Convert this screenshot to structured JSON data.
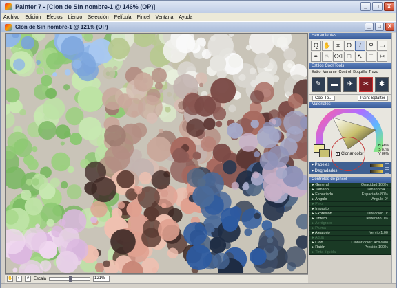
{
  "app": {
    "title": "Painter 7 - [Clon de Sin nombre-1 @ 146% (OP)]",
    "doc_title": "Clon de Sin nombre-1 @ 121% (OP)"
  },
  "menu": [
    "Archivo",
    "Edición",
    "Efectos",
    "Lienzo",
    "Selección",
    "Película",
    "Pincel",
    "Ventana",
    "Ayuda"
  ],
  "window_buttons": {
    "min": "_",
    "max": "□",
    "close": "X"
  },
  "status": {
    "zoom_label": "Escala",
    "zoom_value": "121%",
    "zoom_fraction": 0.5
  },
  "panels": {
    "tools_title": "Herramientas",
    "tools": [
      {
        "icon": "magnifier",
        "glyph": "Q"
      },
      {
        "icon": "hand",
        "glyph": "✋"
      },
      {
        "icon": "crop",
        "glyph": "⌗"
      },
      {
        "icon": "lasso",
        "glyph": "ʘ"
      },
      {
        "icon": "brush",
        "glyph": "/"
      },
      {
        "icon": "dropper",
        "glyph": "⚲"
      },
      {
        "icon": "rectangle",
        "glyph": "▭"
      },
      {
        "icon": "pen",
        "glyph": "✒"
      },
      {
        "icon": "paintbucket",
        "glyph": "♨"
      },
      {
        "icon": "eraser",
        "glyph": "⌫"
      },
      {
        "icon": "shape",
        "glyph": "□"
      },
      {
        "icon": "select",
        "glyph": "↖"
      },
      {
        "icon": "text",
        "glyph": "T"
      },
      {
        "icon": "scissors",
        "glyph": "✂"
      }
    ],
    "brush_title": "Estilos Cool Tools",
    "brush_tabs": [
      "Estilo",
      "Variante",
      "Control",
      "Boquilla",
      "Trazo"
    ],
    "brush_icons": [
      "pencil",
      "charcoal",
      "airbrush",
      "cloner",
      "acrylic"
    ],
    "brush_category": "Cool To...",
    "brush_variant": "Paint Splatter",
    "materials_title": "Materiales",
    "clone_color_label": "Clonar color",
    "hsv": [
      "H 48%",
      "S 81%",
      "V 86%"
    ],
    "drawers": [
      "Papeles",
      "Degradados"
    ],
    "controls_title": "Controles de pincel",
    "controls": [
      {
        "label": "General",
        "value": "Opacidad 100%",
        "enabled": true
      },
      {
        "label": "Tamaño",
        "value": "Tamaño 54.7",
        "enabled": true
      },
      {
        "label": "Espaciado",
        "value": "Espaciado 80%",
        "enabled": true
      },
      {
        "label": "Ángulo",
        "value": "Ángulo 0°",
        "enabled": true
      },
      {
        "label": "Pelo",
        "value": "",
        "enabled": false
      },
      {
        "label": "Impasto",
        "value": "",
        "enabled": true
      },
      {
        "label": "Expresión",
        "value": "Dirección 0°",
        "enabled": true
      },
      {
        "label": "Tintero",
        "value": "Desteñido 0%",
        "enabled": true
      },
      {
        "label": "Aerógrafo",
        "value": "",
        "enabled": false
      },
      {
        "label": "Pluma",
        "value": "",
        "enabled": false
      },
      {
        "label": "Aleatorio",
        "value": "Nervio 1,00",
        "enabled": true
      },
      {
        "label": "Agua",
        "value": "",
        "enabled": false
      },
      {
        "label": "Clon",
        "value": "Clonar color: Activado",
        "enabled": true
      },
      {
        "label": "Ratón",
        "value": "Presión 100%",
        "enabled": true
      },
      {
        "label": "Tinta líquida",
        "value": "",
        "enabled": false
      }
    ]
  },
  "colors": {
    "primary": "#c8c070",
    "secondary": "#f0e8a0",
    "accent": "#3a5c99"
  }
}
